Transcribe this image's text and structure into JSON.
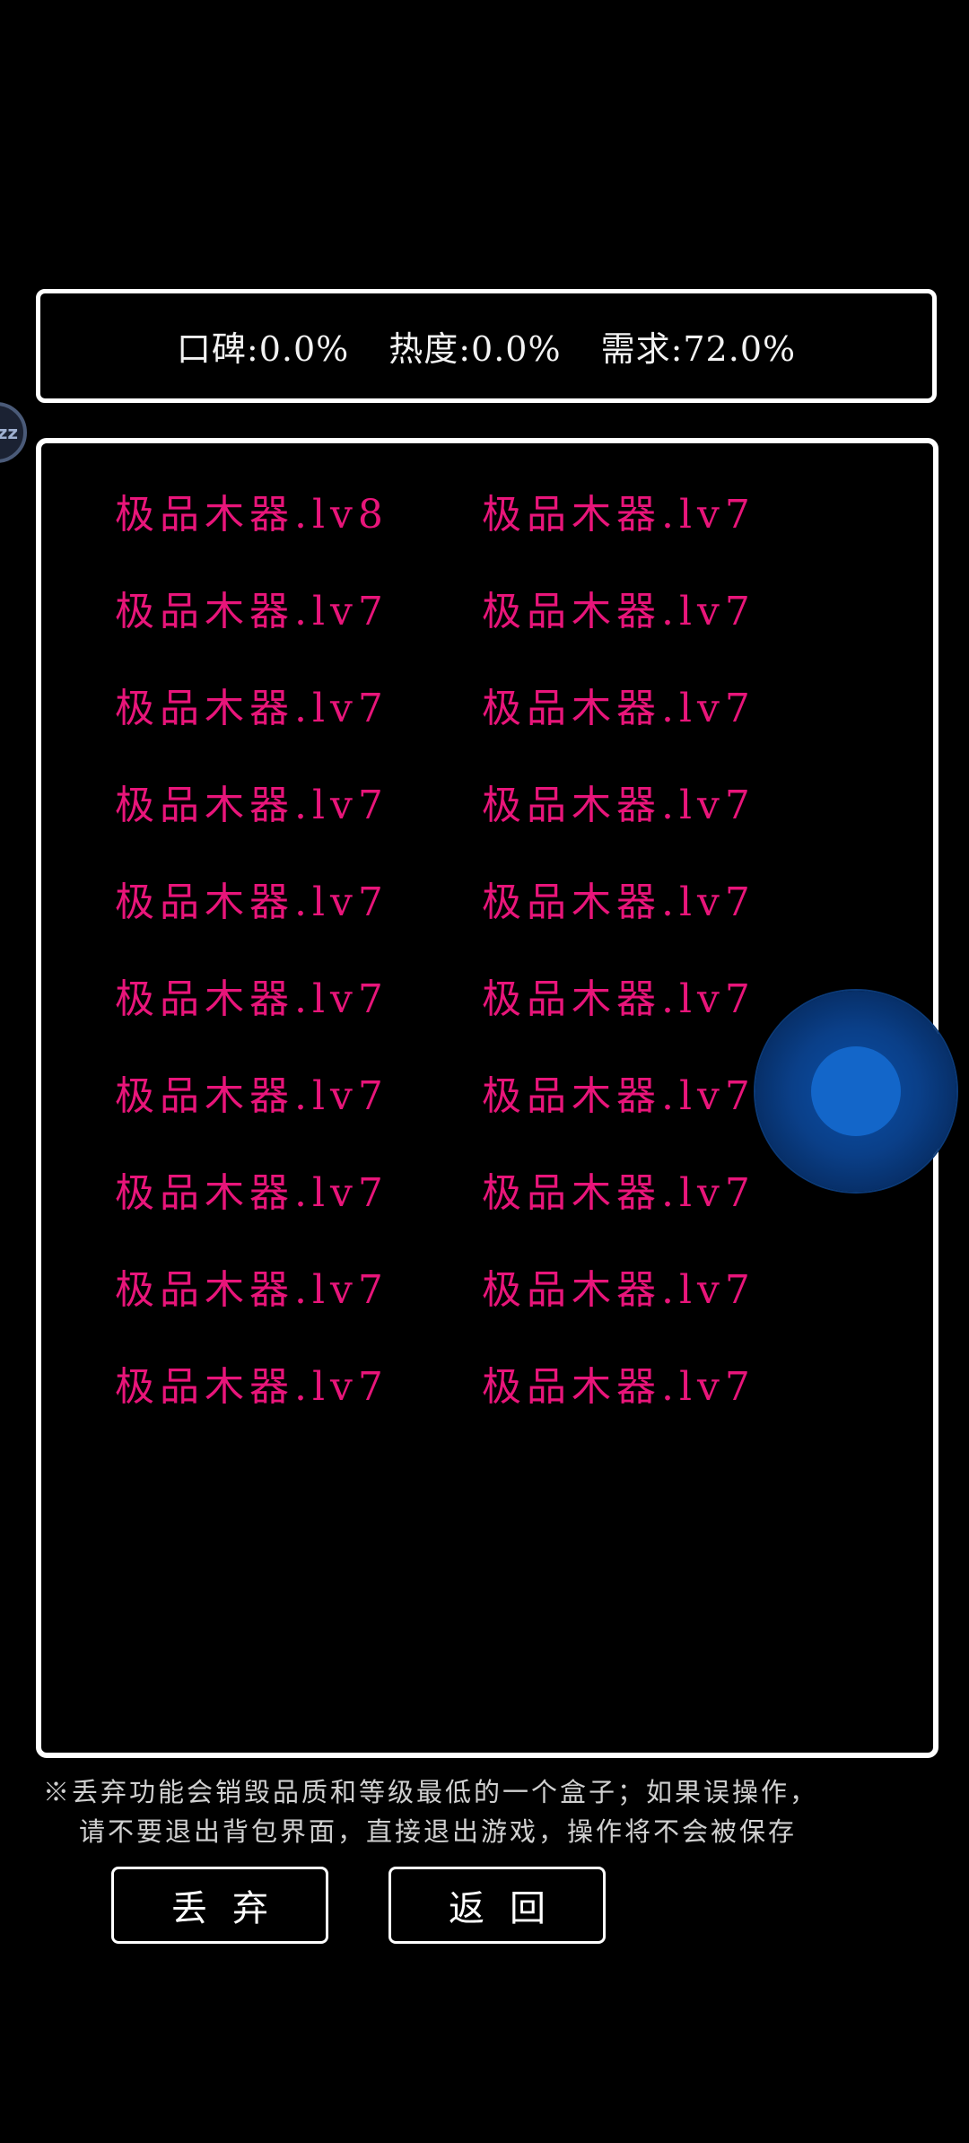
{
  "stats": {
    "reputation": "口碑:0.0%",
    "heat": "热度:0.0%",
    "demand": "需求:72.0%"
  },
  "side_badge": {
    "label": "zz",
    "icon": "sleep-icon"
  },
  "inventory": {
    "items": [
      "极品木器.lv8",
      "极品木器.lv7",
      "极品木器.lv7",
      "极品木器.lv7",
      "极品木器.lv7",
      "极品木器.lv7",
      "极品木器.lv7",
      "极品木器.lv7",
      "极品木器.lv7",
      "极品木器.lv7",
      "极品木器.lv7",
      "极品木器.lv7",
      "极品木器.lv7",
      "极品木器.lv7",
      "极品木器.lv7",
      "极品木器.lv7",
      "极品木器.lv7",
      "极品木器.lv7",
      "极品木器.lv7",
      "极品木器.lv7"
    ],
    "item_color": "#e8157a"
  },
  "notice": {
    "line1": "※丢弃功能会销毁品质和等级最低的一个盒子；如果误操作，",
    "line2": "请不要退出背包界面，直接退出游戏，操作将不会被保存"
  },
  "buttons": {
    "discard": "丢弃",
    "return": "返回"
  },
  "joystick": {
    "color": "#1366c9"
  }
}
